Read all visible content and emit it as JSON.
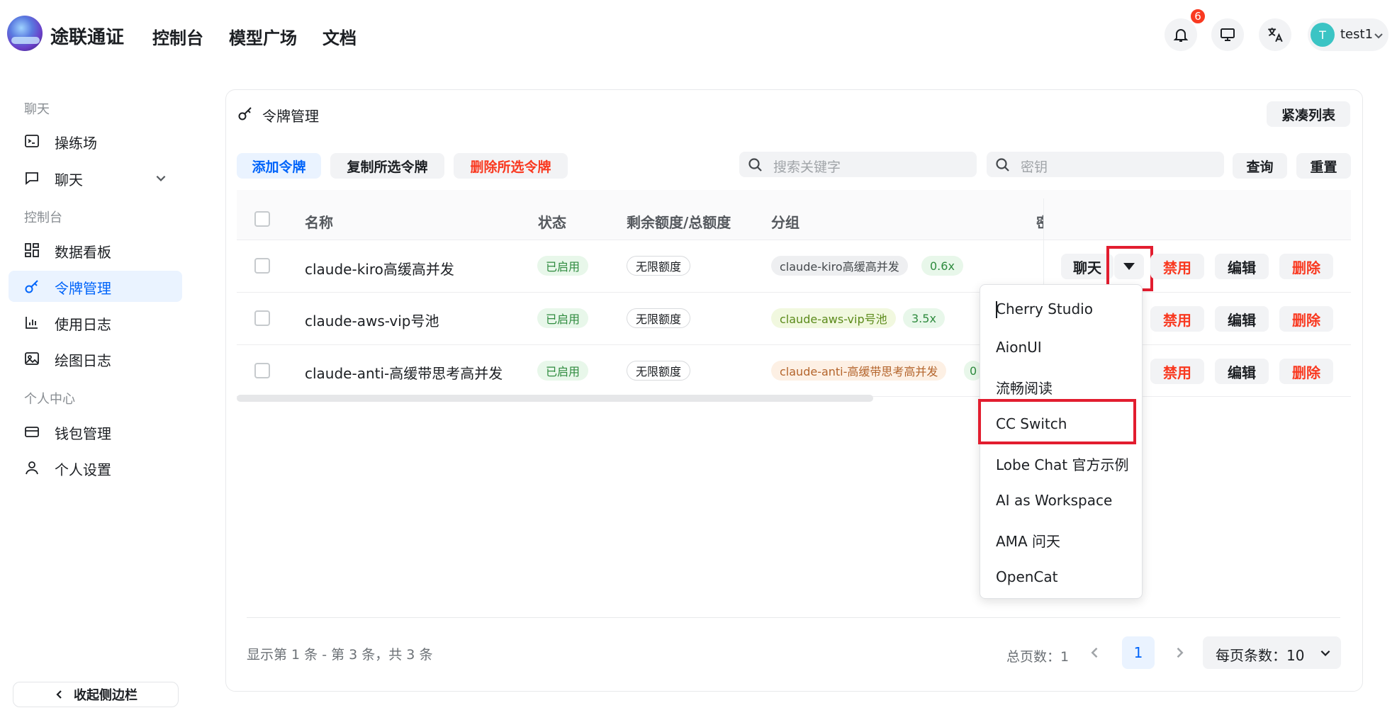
{
  "header": {
    "brand": "途联通证",
    "nav": [
      "控制台",
      "模型广场",
      "文档"
    ],
    "notification_count": "6",
    "avatar_letter": "T",
    "username": "test1"
  },
  "sidebar": {
    "section_chat": "聊天",
    "playground": "操练场",
    "chat": "聊天",
    "section_console": "控制台",
    "dashboard": "数据看板",
    "tokens": "令牌管理",
    "usage_log": "使用日志",
    "draw_log": "绘图日志",
    "section_personal": "个人中心",
    "wallet": "钱包管理",
    "settings": "个人设置",
    "collapse": "收起侧边栏"
  },
  "page": {
    "title": "令牌管理",
    "compact_button": "紧凑列表",
    "add_button": "添加令牌",
    "copy_button": "复制所选令牌",
    "delete_selected_button": "删除所选令牌",
    "search_placeholder": "搜索关键字",
    "key_placeholder": "密钥",
    "query_button": "查询",
    "reset_button": "重置"
  },
  "table": {
    "headers": {
      "name": "名称",
      "status": "状态",
      "quota": "剩余额度/总额度",
      "group": "分组",
      "key_partial": "密"
    },
    "rows": [
      {
        "name": "claude-kiro高缓高并发",
        "status": "已启用",
        "quota": "无限额度",
        "group": "claude-kiro高缓高并发",
        "ratio": "0.6x"
      },
      {
        "name": "claude-aws-vip号池",
        "status": "已启用",
        "quota": "无限额度",
        "group": "claude-aws-vip号池",
        "ratio": "3.5x"
      },
      {
        "name": "claude-anti-高缓带思考高并发",
        "status": "已启用",
        "quota": "无限额度",
        "group": "claude-anti-高缓带思考高并发",
        "ratio": "0"
      }
    ],
    "actions": {
      "chat": "聊天",
      "disable": "禁用",
      "edit": "编辑",
      "delete": "删除"
    }
  },
  "dropdown": {
    "items": [
      "Cherry Studio",
      "AionUI",
      "流畅阅读",
      "CC Switch",
      "Lobe Chat 官方示例",
      "AI as Workspace",
      "AMA 问天",
      "OpenCat"
    ]
  },
  "footer": {
    "page_info": "显示第 1 条 - 第 3 条，共 3 条",
    "total_pages": "总页数：1",
    "current_page": "1",
    "per_page": "每页条数：10"
  }
}
